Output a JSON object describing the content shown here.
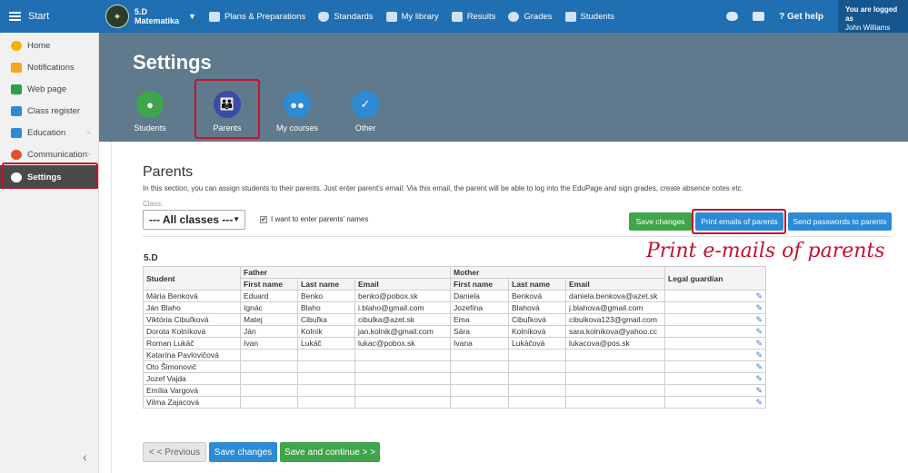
{
  "topbar": {
    "start": "Start",
    "class_code": "5.D",
    "class_school": "Matematika",
    "nav": [
      "Plans & Preparations",
      "Standards",
      "My library",
      "Results",
      "Grades",
      "Students"
    ],
    "get_help": "Get help",
    "logged_line1": "You are logged as",
    "logged_line2": "John Williams"
  },
  "sidebar": {
    "items": [
      {
        "label": "Home",
        "color": "#f4b400"
      },
      {
        "label": "Notifications",
        "color": "#f5a623"
      },
      {
        "label": "Web page",
        "color": "#2e9e4f"
      },
      {
        "label": "Class register",
        "color": "#2d8bd6"
      },
      {
        "label": "Education",
        "color": "#2d8bd6",
        "arrow": ">"
      },
      {
        "label": "Communication",
        "color": "#e0522b",
        "arrow": ">"
      },
      {
        "label": "Settings",
        "color": "#ffffff"
      }
    ]
  },
  "header": {
    "title": "Settings",
    "tabs": [
      "Students",
      "Parents",
      "My courses",
      "Other"
    ]
  },
  "section": {
    "title": "Parents",
    "description": "In this section, you can assign students to their parents. Just enter parent's email. Via this email, the parent will be able to log into the EduPage and sign grades, create absence notes etc.",
    "class_label": "Class:",
    "class_value": "--- All classes ---",
    "names_checkbox": "I want to enter parents' names",
    "btn_save": "Save changes",
    "btn_print": "Print emails of parents",
    "btn_send": "Send passwords to parents",
    "annotation": "Print e-mails of parents",
    "class_heading": "5.D"
  },
  "table": {
    "student_header": "Student",
    "father_header": "Father",
    "mother_header": "Mother",
    "guardian_header": "Legal guardian",
    "sub_headers": [
      "First name",
      "Last name",
      "Email"
    ],
    "rows": [
      {
        "student": "Mária Benková",
        "f_first": "Eduard",
        "f_last": "Benko",
        "f_email": "benko@pobox.sk",
        "m_first": "Daniela",
        "m_last": "Benková",
        "m_email": "daniela.benkova@azet.sk"
      },
      {
        "student": "Ján Blaho",
        "f_first": "Ignác",
        "f_last": "Blaho",
        "f_email": "i.blaho@gmail.com",
        "m_first": "Jozefína",
        "m_last": "Blahová",
        "m_email": "j.blahova@gmail.com"
      },
      {
        "student": "Viktória Cibuľková",
        "f_first": "Matej",
        "f_last": "Cibuľka",
        "f_email": "cibulka@azet.sk",
        "m_first": "Ema",
        "m_last": "Cibuľková",
        "m_email": "cibulkova123@gmail.com"
      },
      {
        "student": "Dorota Kolníková",
        "f_first": "Ján",
        "f_last": "Kolník",
        "f_email": "jan.kolnik@gmail.com",
        "m_first": "Sára",
        "m_last": "Kolníková",
        "m_email": "sara.kolnikova@yahoo.cc"
      },
      {
        "student": "Roman Lukáč",
        "f_first": "Ivan",
        "f_last": "Lukáč",
        "f_email": "lukac@pobox.sk",
        "m_first": "Ivana",
        "m_last": "Lukáčová",
        "m_email": "lukacova@pos.sk"
      },
      {
        "student": "Katarína Pavlovičová",
        "f_first": "",
        "f_last": "",
        "f_email": "",
        "m_first": "",
        "m_last": "",
        "m_email": ""
      },
      {
        "student": "Oto Šimonovič",
        "f_first": "",
        "f_last": "",
        "f_email": "",
        "m_first": "",
        "m_last": "",
        "m_email": ""
      },
      {
        "student": "Jozef Vajda",
        "f_first": "",
        "f_last": "",
        "f_email": "",
        "m_first": "",
        "m_last": "",
        "m_email": ""
      },
      {
        "student": "Emília Vargová",
        "f_first": "",
        "f_last": "",
        "f_email": "",
        "m_first": "",
        "m_last": "",
        "m_email": ""
      },
      {
        "student": "Vilma Zajacová",
        "f_first": "",
        "f_last": "",
        "f_email": "",
        "m_first": "",
        "m_last": "",
        "m_email": ""
      }
    ]
  },
  "footer": {
    "prev": "< < Previous",
    "save": "Save changes",
    "save_continue": "Save and continue > >"
  },
  "colors": {
    "topbar": "#1f6fb2",
    "header": "#5e7a8c",
    "highlight": "#c8102e",
    "save_green": "#3fa54a",
    "action_blue": "#2d8bd6"
  }
}
